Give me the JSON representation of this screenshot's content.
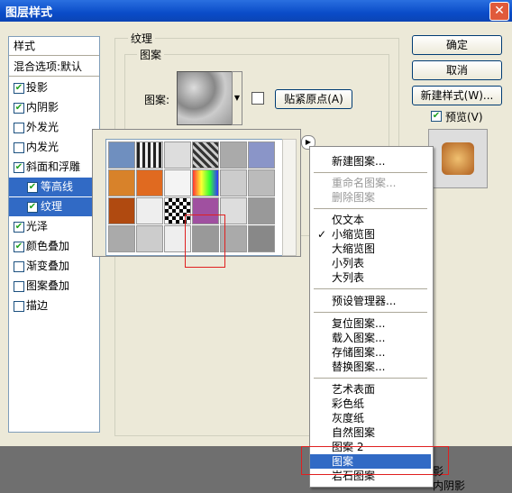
{
  "window": {
    "title": "图层样式",
    "close": "✕"
  },
  "styles_panel": {
    "header": "样式",
    "blend": "混合选项:默认",
    "items": [
      {
        "label": "投影",
        "checked": true
      },
      {
        "label": "内阴影",
        "checked": true
      },
      {
        "label": "外发光",
        "checked": false
      },
      {
        "label": "内发光",
        "checked": false
      },
      {
        "label": "斜面和浮雕",
        "checked": true
      },
      {
        "label": "等高线",
        "checked": true
      },
      {
        "label": "纹理",
        "checked": true
      },
      {
        "label": "光泽",
        "checked": true
      },
      {
        "label": "颜色叠加",
        "checked": true
      },
      {
        "label": "渐变叠加",
        "checked": false
      },
      {
        "label": "图案叠加",
        "checked": false
      },
      {
        "label": "描边",
        "checked": false
      }
    ]
  },
  "texture": {
    "group_label": "纹理",
    "sub_label": "图案",
    "pattern_label": "图案:",
    "snap_button": "贴紧原点(A)"
  },
  "buttons": {
    "ok": "确定",
    "cancel": "取消",
    "new_style": "新建样式(W)...",
    "preview": "预览(V)"
  },
  "menu": {
    "new_pattern": "新建图案...",
    "rename": "重命名图案...",
    "delete": "删除图案",
    "text_only": "仅文本",
    "small_thumb": "小缩览图",
    "large_thumb": "大缩览图",
    "small_list": "小列表",
    "large_list": "大列表",
    "preset_manager": "预设管理器...",
    "reset": "复位图案...",
    "load": "载入图案...",
    "save": "存储图案...",
    "replace": "替换图案...",
    "art_surfaces": "艺术表面",
    "color_paper": "彩色纸",
    "gray_paper": "灰度纸",
    "nature": "自然图案",
    "patterns2": "图案 2",
    "patterns": "图案",
    "rock": "岩石图案"
  },
  "bg": {
    "fragment1": "影",
    "fragment2": "内阴影"
  }
}
